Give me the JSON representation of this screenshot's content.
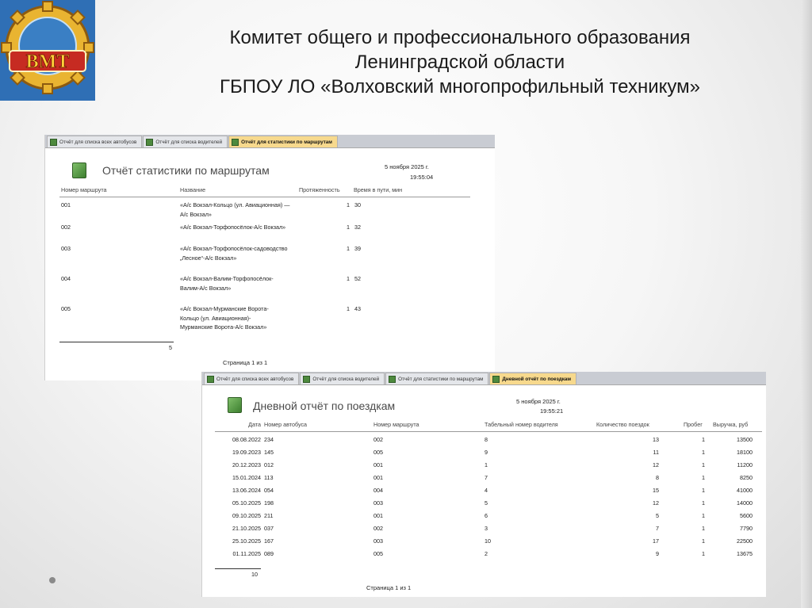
{
  "header": {
    "line1": "Комитет общего и профессионального образования",
    "line2": "Ленинградской области",
    "line3": "ГБПОУ ЛО  «Волховский многопрофильный техникум»"
  },
  "logo": {
    "text": "ВМТ"
  },
  "routes_report": {
    "tabs": [
      {
        "label": "Отчёт для списка всех автобусов",
        "active": false
      },
      {
        "label": "Отчёт для списка водителей",
        "active": false
      },
      {
        "label": "Отчёт для статистики по маршрутам",
        "active": true
      }
    ],
    "title": "Отчёт статистики по маршрутам",
    "date": "5 ноября 2025 г.",
    "time": "19:55:04",
    "columns": [
      "Номер маршрута",
      "Название",
      "Протяженность",
      "Время в пути, мин"
    ],
    "rows": [
      {
        "num": "001",
        "name": "«А/с Вокзал-Кольцо (ул. Авиационная) — А/с Вокзал»",
        "len": "1",
        "time": "30"
      },
      {
        "num": "002",
        "name": "«А/с Вокзал-Торфопосёлок-А/с Вокзал»",
        "len": "1",
        "time": "32"
      },
      {
        "num": "003",
        "name": "«А/с Вокзал-Торфопосёлок-садоводство „Лесное“-А/с Вокзал»",
        "len": "1",
        "time": "39"
      },
      {
        "num": "004",
        "name": "«А/с Вокзал-Валим-Торфопосёлок-Валим-А/с Вокзал»",
        "len": "1",
        "time": "52"
      },
      {
        "num": "005",
        "name": "«А/с Вокзал-Мурманские Ворота-Кольцо (ул. Авиационная)-Мурманские Ворота-А/с Вокзал»",
        "len": "1",
        "time": "43"
      }
    ],
    "total": "5",
    "page": "Страница 1 из 1"
  },
  "trips_report": {
    "tabs": [
      {
        "label": "Отчёт для списка всех автобусов",
        "active": false
      },
      {
        "label": "Отчёт для списка водителей",
        "active": false
      },
      {
        "label": "Отчёт для статистики по маршрутам",
        "active": false
      },
      {
        "label": "Дневной отчёт по поездкам",
        "active": true
      }
    ],
    "title": "Дневной отчёт по поездкам",
    "date": "5 ноября 2025 г.",
    "time": "19:55:21",
    "columns": [
      "Дата",
      "Номер автобуса",
      "Номер маршрута",
      "Табельный номер водителя",
      "Количество поездок",
      "Пробег",
      "Выручка, руб"
    ],
    "rows": [
      {
        "date": "08.08.2022",
        "bus": "234",
        "route": "002",
        "driver": "8",
        "trips": "13",
        "mileage": "1",
        "revenue": "13500"
      },
      {
        "date": "19.09.2023",
        "bus": "145",
        "route": "005",
        "driver": "9",
        "trips": "11",
        "mileage": "1",
        "revenue": "18100"
      },
      {
        "date": "20.12.2023",
        "bus": "012",
        "route": "001",
        "driver": "1",
        "trips": "12",
        "mileage": "1",
        "revenue": "11200"
      },
      {
        "date": "15.01.2024",
        "bus": "113",
        "route": "001",
        "driver": "7",
        "trips": "8",
        "mileage": "1",
        "revenue": "8250"
      },
      {
        "date": "13.06.2024",
        "bus": "054",
        "route": "004",
        "driver": "4",
        "trips": "15",
        "mileage": "1",
        "revenue": "41000"
      },
      {
        "date": "05.10.2025",
        "bus": "198",
        "route": "003",
        "driver": "5",
        "trips": "12",
        "mileage": "1",
        "revenue": "14000"
      },
      {
        "date": "09.10.2025",
        "bus": "211",
        "route": "001",
        "driver": "6",
        "trips": "5",
        "mileage": "1",
        "revenue": "5600"
      },
      {
        "date": "21.10.2025",
        "bus": "037",
        "route": "002",
        "driver": "3",
        "trips": "7",
        "mileage": "1",
        "revenue": "7790"
      },
      {
        "date": "25.10.2025",
        "bus": "167",
        "route": "003",
        "driver": "10",
        "trips": "17",
        "mileage": "1",
        "revenue": "22500"
      },
      {
        "date": "01.11.2025",
        "bus": "089",
        "route": "005",
        "driver": "2",
        "trips": "9",
        "mileage": "1",
        "revenue": "13675"
      }
    ],
    "total": "10",
    "page": "Страница 1 из 1"
  }
}
